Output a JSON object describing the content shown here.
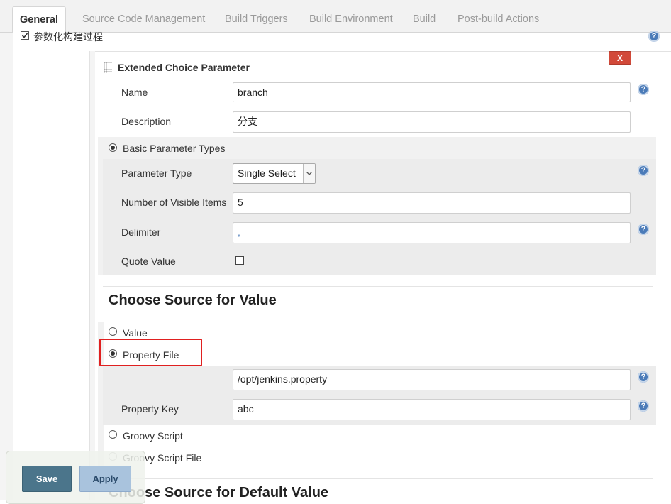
{
  "tabs": [
    {
      "label": "General",
      "active": true
    },
    {
      "label": "Source Code Management"
    },
    {
      "label": "Build Triggers"
    },
    {
      "label": "Build Environment"
    },
    {
      "label": "Build"
    },
    {
      "label": "Post-build Actions"
    }
  ],
  "parameterized_label": "参数化构建过程",
  "parameter": {
    "title": "Extended Choice Parameter",
    "delete_label": "X",
    "name_label": "Name",
    "name_value": "branch",
    "description_label": "Description",
    "description_value": "分支"
  },
  "basic": {
    "radio_label": "Basic Parameter Types",
    "param_type_label": "Parameter Type",
    "param_type_value": "Single Select",
    "visible_items_label": "Number of Visible Items",
    "visible_items_value": "5",
    "delimiter_label": "Delimiter",
    "delimiter_value": ",",
    "quote_label": "Quote Value"
  },
  "source_value": {
    "heading": "Choose Source for Value",
    "option_value": "Value",
    "option_property_file": "Property File",
    "property_file_value": "/opt/jenkins.property",
    "property_key_label": "Property Key",
    "property_key_value": "abc",
    "option_groovy_script": "Groovy Script",
    "option_groovy_file": "Groovy Script File"
  },
  "default_heading": "Choose Source for Default Value",
  "buttons": {
    "save": "Save",
    "apply": "Apply"
  },
  "help_glyph": "?",
  "colors": {
    "delete": "#d24939",
    "save": "#4b758b",
    "apply": "#a9c3dd",
    "highlight": "#e02020",
    "help": "#4b7bb8"
  }
}
